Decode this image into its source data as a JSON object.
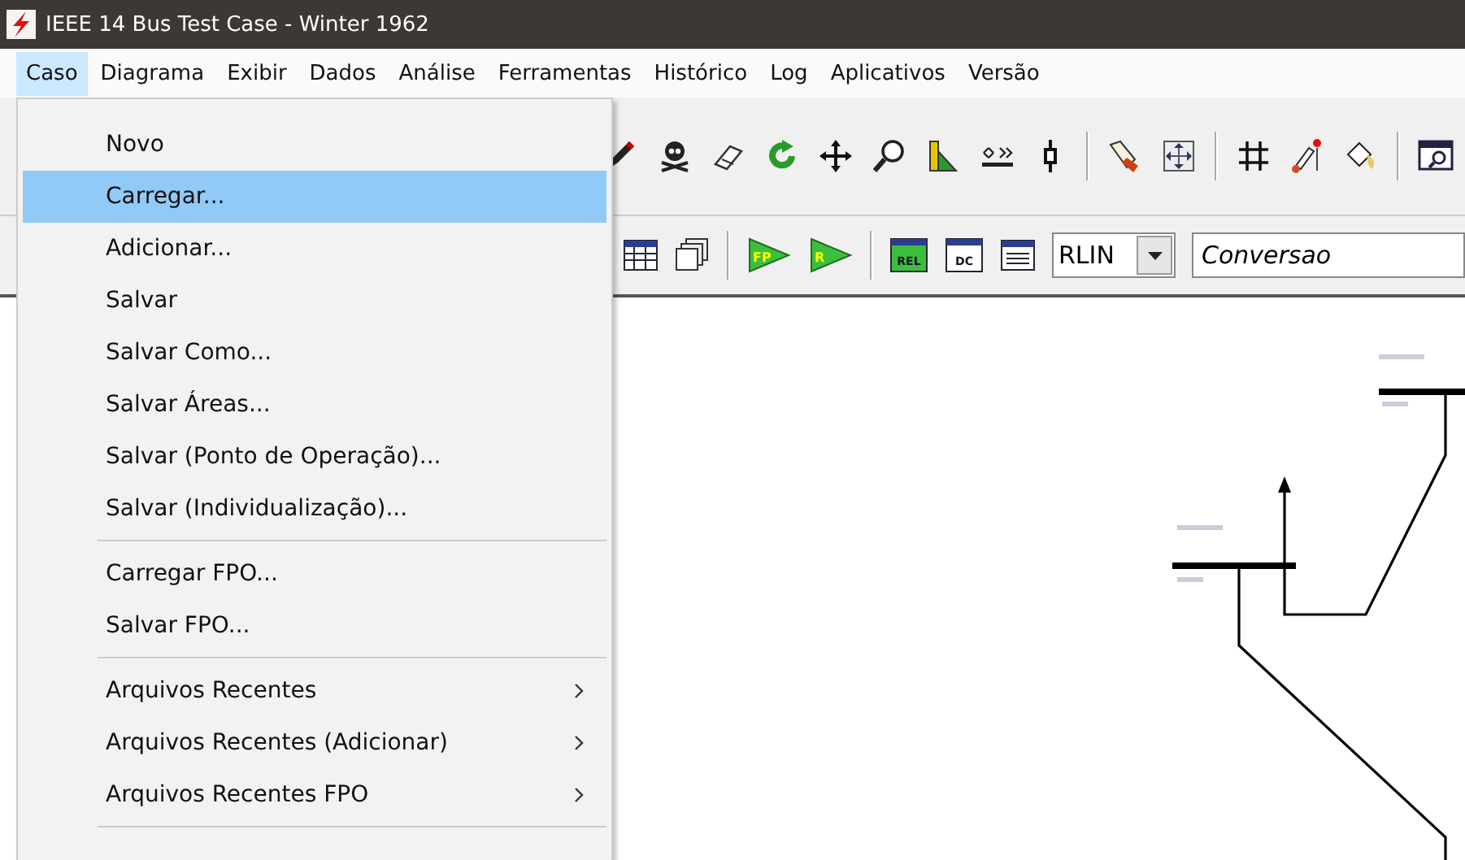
{
  "window": {
    "title": "IEEE 14 Bus Test Case - Winter 1962"
  },
  "menu_bar": [
    {
      "label": "Caso",
      "selected": true
    },
    {
      "label": "Diagrama",
      "selected": false
    },
    {
      "label": "Exibir",
      "selected": false
    },
    {
      "label": "Dados",
      "selected": false
    },
    {
      "label": "Análise",
      "selected": false
    },
    {
      "label": "Ferramentas",
      "selected": false
    },
    {
      "label": "Histórico",
      "selected": false
    },
    {
      "label": "Log",
      "selected": false
    },
    {
      "label": "Aplicativos",
      "selected": false
    },
    {
      "label": "Versão",
      "selected": false
    }
  ],
  "dropdown": {
    "items": [
      {
        "kind": "item",
        "label": "Novo",
        "selected": false,
        "submenu": false
      },
      {
        "kind": "item",
        "label": "Carregar...",
        "selected": true,
        "submenu": false
      },
      {
        "kind": "item",
        "label": "Adicionar...",
        "selected": false,
        "submenu": false
      },
      {
        "kind": "item",
        "label": "Salvar",
        "selected": false,
        "submenu": false
      },
      {
        "kind": "item",
        "label": "Salvar Como...",
        "selected": false,
        "submenu": false
      },
      {
        "kind": "item",
        "label": "Salvar Áreas...",
        "selected": false,
        "submenu": false
      },
      {
        "kind": "item",
        "label": "Salvar (Ponto de Operação)...",
        "selected": false,
        "submenu": false
      },
      {
        "kind": "item",
        "label": "Salvar (Individualização)...",
        "selected": false,
        "submenu": false
      },
      {
        "kind": "separator"
      },
      {
        "kind": "item",
        "label": "Carregar FPO...",
        "selected": false,
        "submenu": false
      },
      {
        "kind": "item",
        "label": "Salvar FPO...",
        "selected": false,
        "submenu": false
      },
      {
        "kind": "separator"
      },
      {
        "kind": "item",
        "label": "Arquivos Recentes",
        "selected": false,
        "submenu": true
      },
      {
        "kind": "item",
        "label": "Arquivos Recentes (Adicionar)",
        "selected": false,
        "submenu": true
      },
      {
        "kind": "item",
        "label": "Arquivos Recentes FPO",
        "selected": false,
        "submenu": true
      },
      {
        "kind": "separator"
      }
    ]
  },
  "toolbar_2": {
    "button_labels": [
      "FP",
      "R",
      "REL",
      "DC"
    ],
    "combo": {
      "value": "RLIN"
    },
    "field": {
      "value": "Conversao"
    }
  }
}
